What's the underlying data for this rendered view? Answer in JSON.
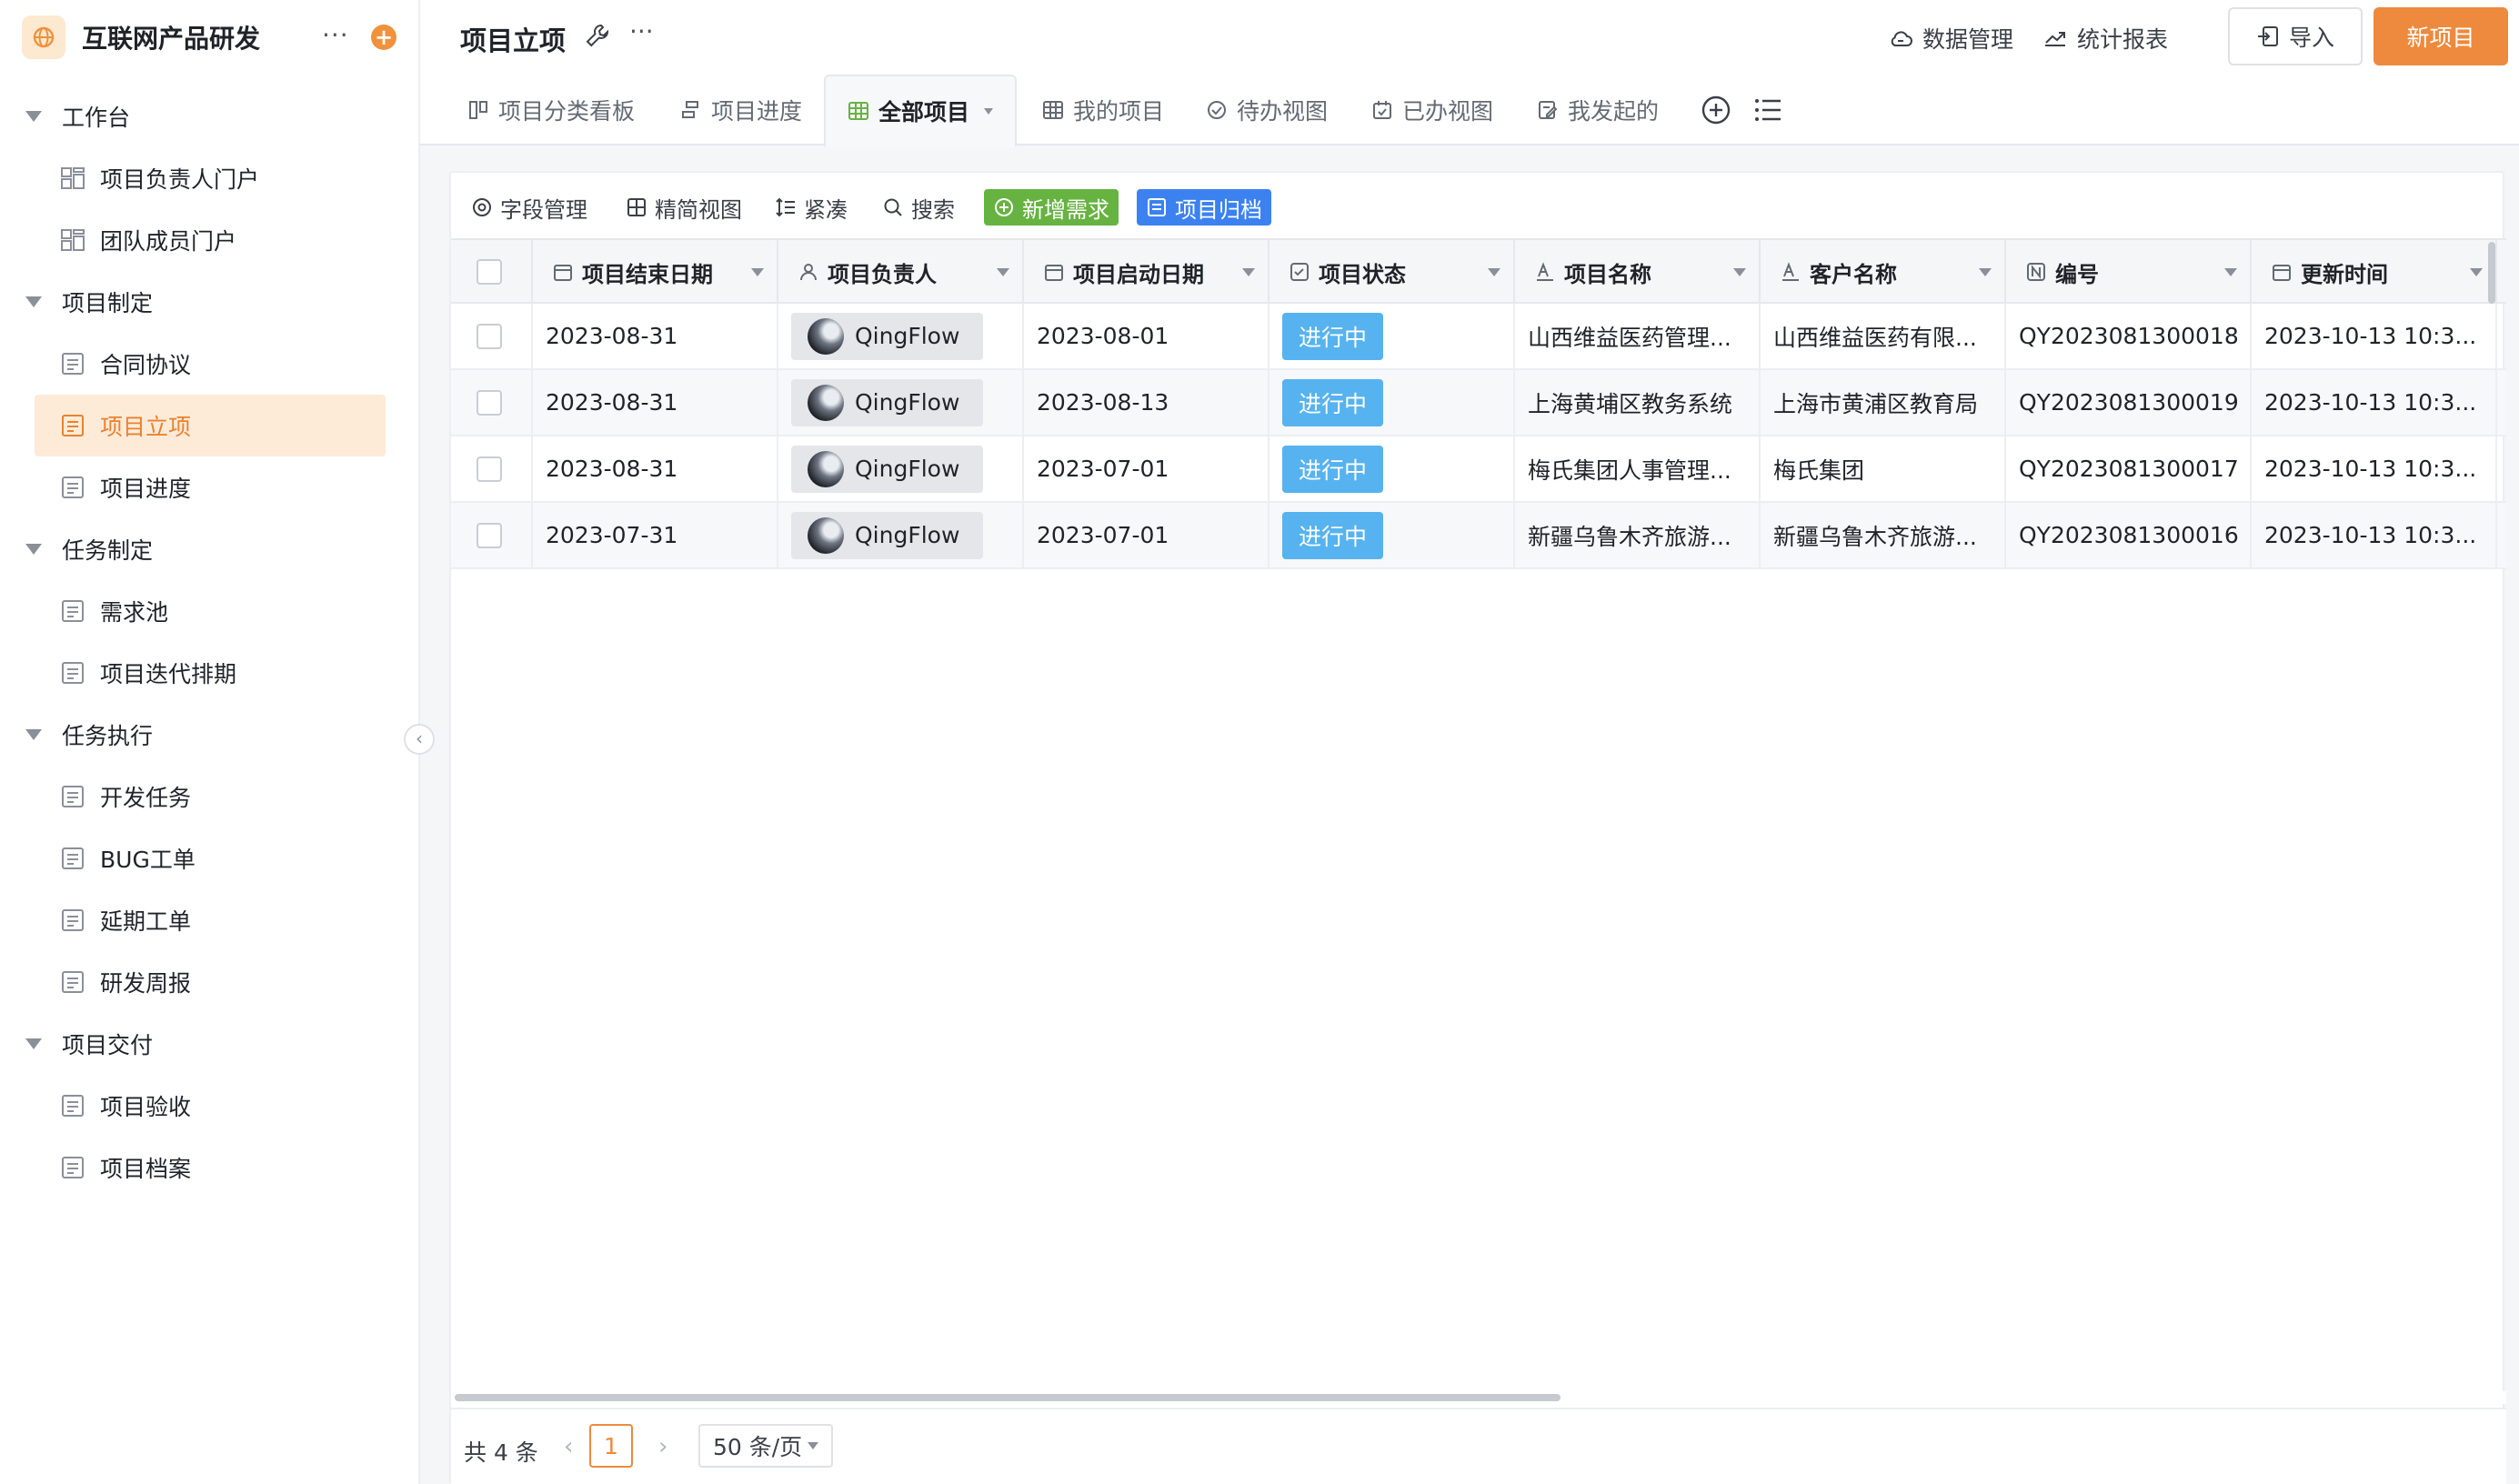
{
  "app": {
    "title": "互联网产品研发",
    "more": "···",
    "add": "+"
  },
  "sidebar": {
    "groups": [
      {
        "label": "工作台",
        "items": [
          "项目负责人门户",
          "团队成员门户"
        ]
      },
      {
        "label": "项目制定",
        "items": [
          "合同协议",
          "项目立项",
          "项目进度"
        ]
      },
      {
        "label": "任务制定",
        "items": [
          "需求池",
          "项目迭代排期"
        ]
      },
      {
        "label": "任务执行",
        "items": [
          "开发任务",
          "BUG工单",
          "延期工单",
          "研发周报"
        ]
      },
      {
        "label": "项目交付",
        "items": [
          "项目验收",
          "项目档案"
        ]
      }
    ],
    "active_item": "项目立项"
  },
  "header": {
    "title": "项目立项",
    "more": "···",
    "data_mgmt": "数据管理",
    "stats": "统计报表",
    "import": "导入",
    "new": "新项目"
  },
  "tabs": [
    {
      "label": "项目分类看板",
      "icon": "kanban-icon"
    },
    {
      "label": "项目进度",
      "icon": "gantt-icon"
    },
    {
      "label": "全部项目",
      "icon": "table-icon",
      "active": true
    },
    {
      "label": "我的项目",
      "icon": "table-icon"
    },
    {
      "label": "待办视图",
      "icon": "check-circle-icon"
    },
    {
      "label": "已办视图",
      "icon": "calendar-check-icon"
    },
    {
      "label": "我发起的",
      "icon": "edit-doc-icon"
    }
  ],
  "toolbar": {
    "fields": "字段管理",
    "compact_view": "精简视图",
    "dense": "紧凑",
    "search": "搜索",
    "new_requirement": "新增需求",
    "archive": "项目归档"
  },
  "columns": [
    "项目结束日期",
    "项目负责人",
    "项目启动日期",
    "项目状态",
    "项目名称",
    "客户名称",
    "编号",
    "更新时间"
  ],
  "rows": [
    {
      "end": "2023-08-31",
      "owner": "QingFlow",
      "start": "2023-08-01",
      "status": "进行中",
      "name": "山西维益医药管理...",
      "customer": "山西维益医药有限...",
      "code": "QY2023081300018",
      "updated": "2023-10-13 10:3..."
    },
    {
      "end": "2023-08-31",
      "owner": "QingFlow",
      "start": "2023-08-13",
      "status": "进行中",
      "name": "上海黄埔区教务系统",
      "customer": "上海市黄浦区教育局",
      "code": "QY2023081300019",
      "updated": "2023-10-13 10:3..."
    },
    {
      "end": "2023-08-31",
      "owner": "QingFlow",
      "start": "2023-07-01",
      "status": "进行中",
      "name": "梅氏集团人事管理...",
      "customer": "梅氏集团",
      "code": "QY2023081300017",
      "updated": "2023-10-13 10:3..."
    },
    {
      "end": "2023-07-31",
      "owner": "QingFlow",
      "start": "2023-07-01",
      "status": "进行中",
      "name": "新疆乌鲁木齐旅游...",
      "customer": "新疆乌鲁木齐旅游...",
      "code": "QY2023081300016",
      "updated": "2023-10-13 10:3..."
    }
  ],
  "footer": {
    "total": "共 4 条",
    "current_page": "1",
    "page_size": "50 条/页"
  },
  "colors": {
    "accent": "#ee8a3d",
    "status": "#56b3ef",
    "green": "#67b341",
    "blue": "#3b82f0"
  }
}
